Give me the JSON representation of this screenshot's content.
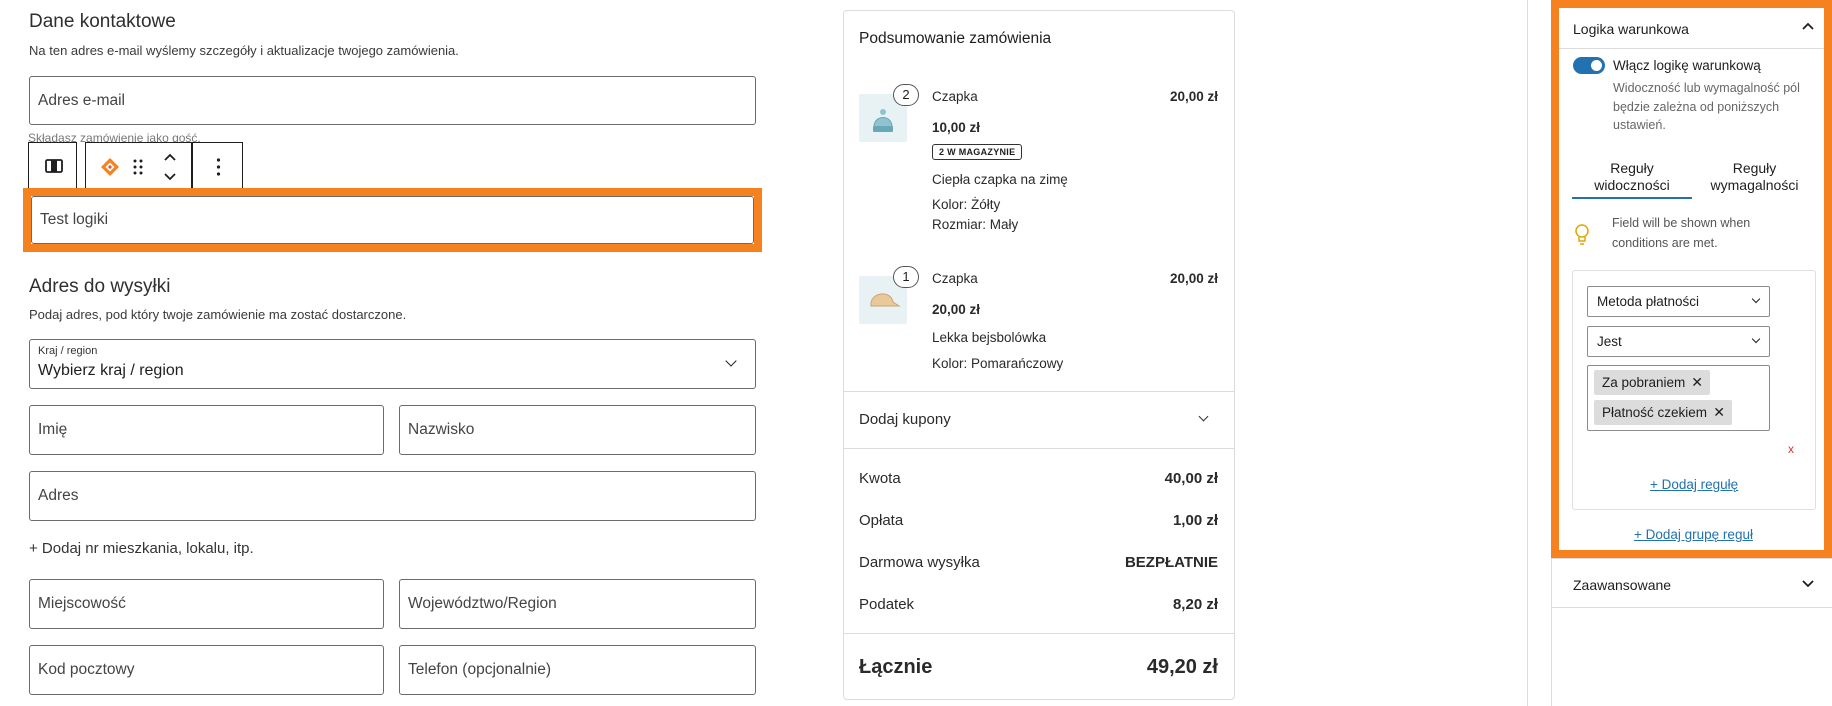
{
  "contact": {
    "title": "Dane kontaktowe",
    "subtitle": "Na ten adres e-mail wyślemy szczegóły i aktualizacje twojego zamówienia.",
    "email_placeholder": "Adres e-mail",
    "guest_note": "Składasz zamówienie jako gość."
  },
  "block": {
    "field_label": "Test logiki"
  },
  "shipping": {
    "title": "Adres do wysyłki",
    "subtitle": "Podaj adres, pod który twoje zamówienie ma zostać dostarczone.",
    "country_label": "Kraj / region",
    "country_value": "Wybierz kraj / region",
    "first_name": "Imię",
    "last_name": "Nazwisko",
    "address": "Adres",
    "add_apartment": "+ Dodaj nr mieszkania, lokalu, itp.",
    "city": "Miejscowość",
    "state": "Województwo/Region",
    "postcode": "Kod pocztowy",
    "phone": "Telefon (opcjonalnie)"
  },
  "summary": {
    "title": "Podsumowanie zamówienia",
    "items": [
      {
        "qty": "2",
        "name": "Czapka",
        "price": "20,00 zł",
        "unit_price": "10,00 zł",
        "stock": "2 W MAGAZYNIE",
        "desc": "Ciepła czapka na zimę",
        "meta1": "Kolor: Żółty",
        "meta2": "Rozmiar: Mały"
      },
      {
        "qty": "1",
        "name": "Czapka",
        "price": "20,00 zł",
        "unit_price": "20,00 zł",
        "desc": "Lekka bejsbolówka",
        "meta1": "Kolor: Pomarańczowy"
      }
    ],
    "coupon": "Dodaj kupony",
    "rows": [
      {
        "label": "Kwota",
        "value": "40,00 zł"
      },
      {
        "label": "Opłata",
        "value": "1,00 zł"
      },
      {
        "label": "Darmowa wysyłka",
        "value": "BEZPŁATNIE"
      },
      {
        "label": "Podatek",
        "value": "8,20 zł"
      }
    ],
    "total_label": "Łącznie",
    "total_value": "49,20 zł"
  },
  "panel": {
    "section_title": "Logika warunkowa",
    "toggle_label": "Włącz logikę warunkową",
    "toggle_on": true,
    "help": [
      "Widoczność lub wymagalność pól",
      "będzie zależna od poniższych",
      "ustawień."
    ],
    "tab1": [
      "Reguły",
      "widoczności"
    ],
    "tab2": [
      "Reguły",
      "wymagalności"
    ],
    "hint": [
      "Field will be shown when",
      "conditions are met."
    ],
    "rule_field": "Metoda płatności",
    "rule_operator": "Jest",
    "tokens": [
      "Za pobraniem",
      "Płatność czekiem"
    ],
    "remove": "x",
    "add_rule": "+ Dodaj regułę",
    "add_group": "+ Dodaj grupę reguł",
    "advanced": "Zaawansowane"
  },
  "colors": {
    "highlight": "#f5821f",
    "accent": "#2271b1"
  }
}
